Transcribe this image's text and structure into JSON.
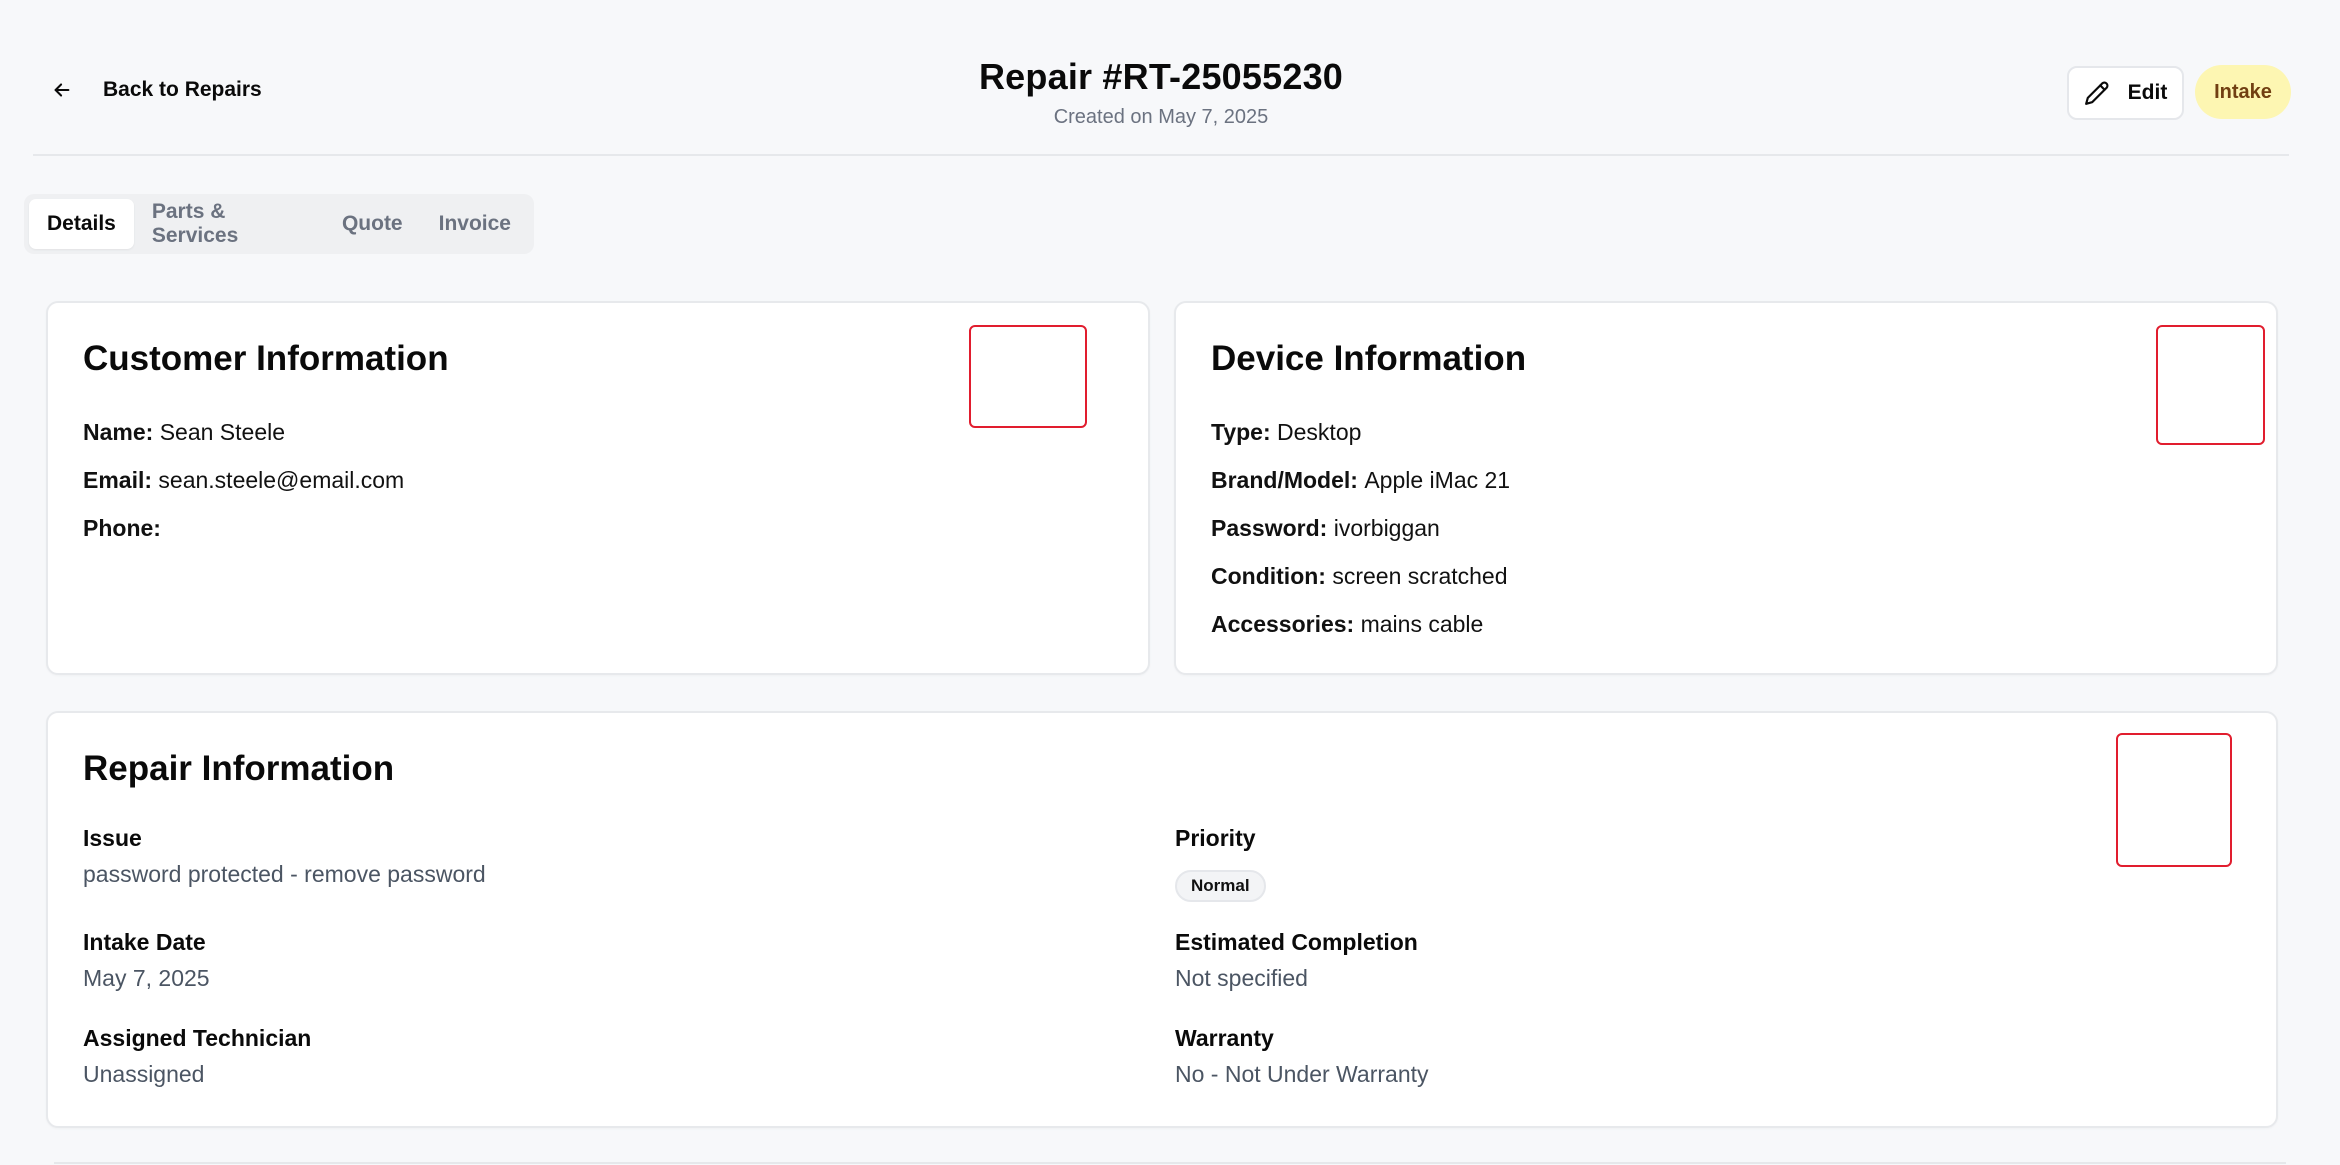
{
  "header": {
    "back_label": "Back to Repairs",
    "title": "Repair #RT-25055230",
    "subtitle": "Created on May 7, 2025",
    "edit_label": "Edit",
    "status": "Intake",
    "status_color": "#fdf6b2"
  },
  "tabs": [
    {
      "label": "Details",
      "active": true
    },
    {
      "label": "Parts & Services",
      "active": false
    },
    {
      "label": "Quote",
      "active": false
    },
    {
      "label": "Invoice",
      "active": false
    }
  ],
  "customer": {
    "title": "Customer Information",
    "name_label": "Name:",
    "name": "Sean Steele",
    "email_label": "Email:",
    "email": "sean.steele@email.com",
    "phone_label": "Phone:",
    "phone": ""
  },
  "device": {
    "title": "Device Information",
    "type_label": "Type:",
    "type": "Desktop",
    "brand_label": "Brand/Model:",
    "brand": "Apple iMac 21",
    "password_label": "Password:",
    "password": "ivorbiggan",
    "condition_label": "Condition:",
    "condition": "screen scratched",
    "accessories_label": "Accessories:",
    "accessories": "mains cable"
  },
  "repair": {
    "title": "Repair Information",
    "issue_label": "Issue",
    "issue": "password protected - remove password",
    "priority_label": "Priority",
    "priority": "Normal",
    "intake_label": "Intake Date",
    "intake": "May 7, 2025",
    "est_label": "Estimated Completion",
    "est": "Not specified",
    "tech_label": "Assigned Technician",
    "tech": "Unassigned",
    "warranty_label": "Warranty",
    "warranty": "No - Not Under Warranty"
  },
  "icons": {
    "back": "arrow-left-icon",
    "edit": "pencil-icon"
  },
  "colors": {
    "accent_red": "#e11d2e",
    "status_text": "#713f12"
  }
}
